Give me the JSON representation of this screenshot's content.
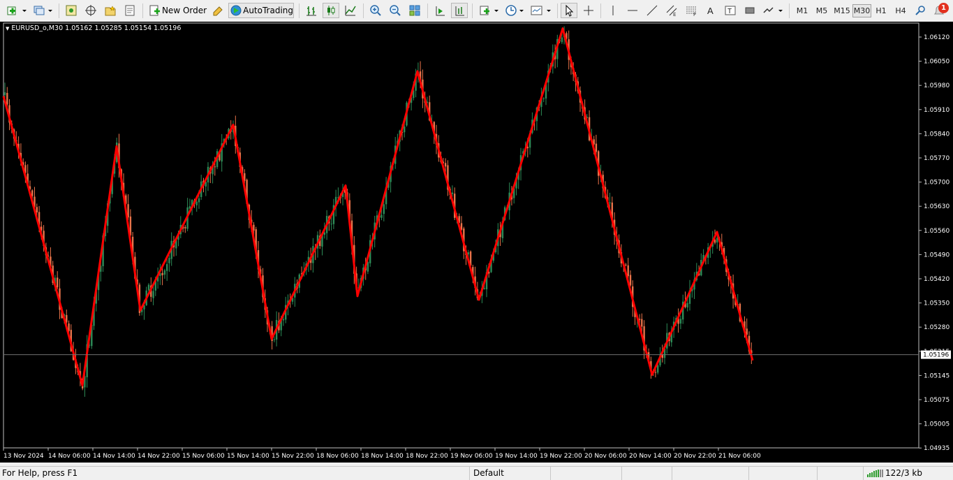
{
  "toolbar": {
    "new_order_label": "New Order",
    "autotrading_label": "AutoTrading",
    "timeframes": [
      "M1",
      "M5",
      "M15",
      "M30",
      "H1",
      "H4"
    ],
    "active_timeframe": "M30",
    "notification_count": "1"
  },
  "chart": {
    "symbol_label": "EURUSD_o,M30  1.05162 1.05285 1.05154 1.05196",
    "current_price_label": "1.05196",
    "background_color": "#000000",
    "bull_color": "#2e8b57",
    "bear_color": "#e9734a",
    "zigzag_color": "#ff0000"
  },
  "chart_data": {
    "type": "candlestick",
    "symbol": "EURUSD_o",
    "timeframe": "M30",
    "ohlc_current": {
      "open": 1.05162,
      "high": 1.05285,
      "low": 1.05154,
      "close": 1.05196
    },
    "ylim": [
      1.04935,
      1.06125
    ],
    "y_ticks": [
      "1.06120",
      "1.06050",
      "1.05980",
      "1.05910",
      "1.05840",
      "1.05770",
      "1.05700",
      "1.05630",
      "1.05560",
      "1.05490",
      "1.05420",
      "1.05350",
      "1.05280",
      "1.05215",
      "1.05145",
      "1.05075",
      "1.05005",
      "1.04935"
    ],
    "x_tick_labels": [
      "13 Nov 2024",
      "14 Nov 06:00",
      "14 Nov 14:00",
      "14 Nov 22:00",
      "15 Nov 06:00",
      "15 Nov 14:00",
      "15 Nov 22:00",
      "18 Nov 06:00",
      "18 Nov 14:00",
      "18 Nov 22:00",
      "19 Nov 06:00",
      "19 Nov 14:00",
      "19 Nov 22:00",
      "20 Nov 06:00",
      "20 Nov 14:00",
      "20 Nov 22:00",
      "21 Nov 06:00"
    ],
    "zigzag_points": [
      1.0592,
      1.0511,
      1.0578,
      1.0532,
      1.0584,
      1.0524,
      1.0567,
      1.0536,
      1.0599,
      1.0535,
      1.0611,
      1.0514,
      1.0554,
      1.0518
    ]
  },
  "status": {
    "help_text": "For Help, press F1",
    "profile": "Default",
    "traffic": "122/3 kb"
  }
}
